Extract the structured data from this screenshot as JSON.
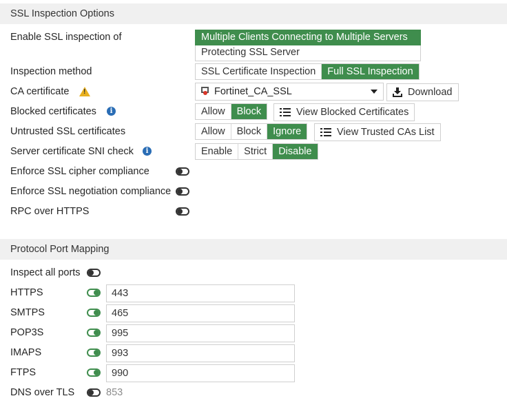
{
  "ssl_section": {
    "title": "SSL Inspection Options",
    "enable_label": "Enable SSL inspection of",
    "enable_options": [
      "Multiple Clients Connecting to Multiple Servers",
      "Protecting SSL Server"
    ],
    "enable_selected": "Multiple Clients Connecting to Multiple Servers",
    "inspection_method_label": "Inspection method",
    "inspection_method_options": [
      "SSL Certificate Inspection",
      "Full SSL Inspection"
    ],
    "inspection_method_selected": "Full SSL Inspection",
    "ca_cert_label": "CA certificate",
    "ca_cert_value": "Fortinet_CA_SSL",
    "download_label": "Download",
    "blocked_certs_label": "Blocked certificates",
    "blocked_certs_options": [
      "Allow",
      "Block"
    ],
    "blocked_certs_selected": "Block",
    "view_blocked_label": "View Blocked Certificates",
    "untrusted_label": "Untrusted SSL certificates",
    "untrusted_options": [
      "Allow",
      "Block",
      "Ignore"
    ],
    "untrusted_selected": "Ignore",
    "view_trusted_label": "View Trusted CAs List",
    "sni_label": "Server certificate SNI check",
    "sni_options": [
      "Enable",
      "Strict",
      "Disable"
    ],
    "sni_selected": "Disable",
    "cipher_label": "Enforce SSL cipher compliance",
    "cipher_enabled": false,
    "negotiation_label": "Enforce SSL negotiation compliance",
    "negotiation_enabled": false,
    "rpc_label": "RPC over HTTPS",
    "rpc_enabled": false
  },
  "port_section": {
    "title": "Protocol Port Mapping",
    "inspect_all_label": "Inspect all ports",
    "inspect_all_enabled": false,
    "protocols": [
      {
        "name": "HTTPS",
        "enabled": true,
        "port": "443"
      },
      {
        "name": "SMTPS",
        "enabled": true,
        "port": "465"
      },
      {
        "name": "POP3S",
        "enabled": true,
        "port": "995"
      },
      {
        "name": "IMAPS",
        "enabled": true,
        "port": "993"
      },
      {
        "name": "FTPS",
        "enabled": true,
        "port": "990"
      },
      {
        "name": "DNS over TLS",
        "enabled": false,
        "port": "853"
      }
    ]
  },
  "colors": {
    "accent_green": "#3f8d4d",
    "info_blue": "#2a6db5",
    "warning_yellow": "#e8b020",
    "section_bg": "#f0f0f0"
  },
  "icons": {
    "warning": "warning-triangle-icon",
    "info": "info-circle-icon",
    "download": "download-icon",
    "list": "list-icon",
    "certificate": "certificate-icon"
  }
}
